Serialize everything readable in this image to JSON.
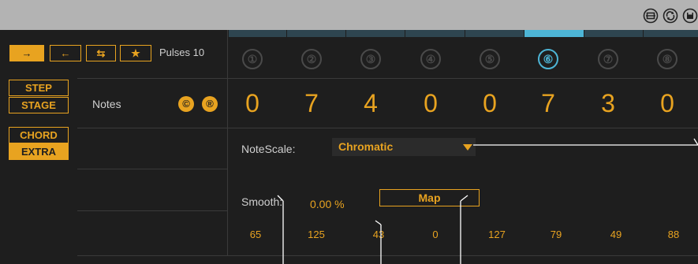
{
  "window": {
    "icons": [
      "wrap-icon",
      "hotswap-icon",
      "save-icon"
    ]
  },
  "toolbar": {
    "direction_buttons": [
      {
        "name": "forward",
        "glyph": "→",
        "active": true
      },
      {
        "name": "backward",
        "glyph": "←",
        "active": false
      },
      {
        "name": "pingpong",
        "glyph": "⇆",
        "active": false
      },
      {
        "name": "random",
        "glyph": "★",
        "active": false
      }
    ],
    "pulses_label": "Pulses 10"
  },
  "modes": [
    {
      "label": "STEP",
      "active": false
    },
    {
      "label": "STAGE",
      "active": false
    },
    {
      "label": "CHORD",
      "active": false
    },
    {
      "label": "EXTRA",
      "active": true
    }
  ],
  "steps": {
    "active_index": 6,
    "numbers": [
      "①",
      "②",
      "③",
      "④",
      "⑤",
      "⑥",
      "⑦",
      "⑧"
    ]
  },
  "notes": {
    "label": "Notes",
    "symbols": [
      "©",
      "®"
    ],
    "values": [
      "0",
      "7",
      "4",
      "0",
      "0",
      "7",
      "3",
      "0"
    ]
  },
  "note_scale": {
    "label": "NoteScale:",
    "value": "Chromatic"
  },
  "smooth": {
    "label": "Smooth:",
    "value": "0.00 %",
    "map_label": "Map"
  },
  "cc_values": [
    "65",
    "125",
    "43",
    "0",
    "127",
    "79",
    "49",
    "88"
  ],
  "colors": {
    "accent": "#e8a320",
    "active_step": "#4db5d6",
    "background": "#1e1e1e",
    "titlebar": "#b3b3b3"
  }
}
